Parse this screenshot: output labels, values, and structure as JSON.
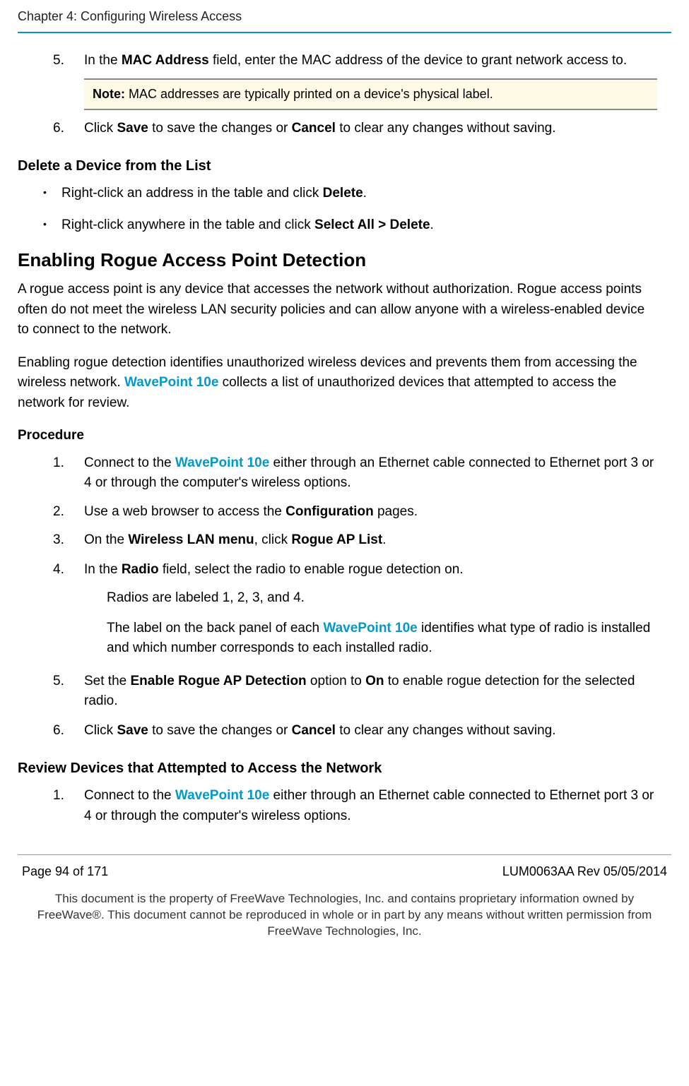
{
  "header": {
    "chapter": "Chapter 4: Configuring Wireless Access"
  },
  "step5": {
    "num": "5.",
    "text_pre": "In the ",
    "bold1": "MAC Address",
    "text_post": " field, enter the MAC address of the device to grant network access to."
  },
  "note": {
    "label": "Note:",
    "text": " MAC addresses are typically printed on a device's physical label."
  },
  "step6": {
    "num": "6.",
    "text_pre": "Click ",
    "bold1": "Save",
    "text_mid": " to save the changes or ",
    "bold2": "Cancel",
    "text_post": " to clear any changes without saving."
  },
  "delete_section": {
    "title": "Delete a Device from the List",
    "bullet1_pre": "Right-click an address in the table and click ",
    "bullet1_bold": "Delete",
    "bullet1_post": ".",
    "bullet2_pre": "Right-click anywhere in the table and click ",
    "bullet2_bold": "Select All > Delete",
    "bullet2_post": "."
  },
  "rogue_section": {
    "title": "Enabling Rogue Access Point Detection",
    "para1": "A rogue access point is any device that accesses the network without authorization. Rogue access points often do not meet the wireless LAN security policies and can allow anyone with a wireless-enabled device to connect to the network.",
    "para2_pre": "Enabling rogue detection identifies unauthorized wireless devices and prevents them from accessing the wireless network. ",
    "para2_link": "WavePoint 10e",
    "para2_post": " collects a list of unauthorized devices that attempted to access the network for review."
  },
  "procedure": {
    "title": "Procedure",
    "s1": {
      "num": "1.",
      "pre": "Connect to the ",
      "link": "WavePoint 10e",
      "post": " either through an Ethernet cable connected to Ethernet port 3 or 4 or through the computer's wireless options."
    },
    "s2": {
      "num": "2.",
      "pre": "Use a web browser to access the ",
      "bold": "Configuration",
      "post": " pages."
    },
    "s3": {
      "num": "3.",
      "pre": "On the ",
      "bold1": "Wireless LAN menu",
      "mid": ", click ",
      "bold2": "Rogue AP List",
      "post": "."
    },
    "s4": {
      "num": "4.",
      "pre": "In the ",
      "bold": "Radio",
      "post": " field, select the radio to enable rogue detection on.",
      "sub1": "Radios are labeled 1, 2, 3, and 4.",
      "sub2_pre": "The label on the back panel of each ",
      "sub2_link": "WavePoint 10e",
      "sub2_post": " identifies what type of radio is installed and which number corresponds to each installed radio."
    },
    "s5": {
      "num": "5.",
      "pre": "Set the ",
      "bold1": "Enable Rogue AP Detection",
      "mid": " option to ",
      "bold2": "On",
      "post": " to enable rogue detection for the selected radio."
    },
    "s6": {
      "num": "6.",
      "pre": "Click ",
      "bold1": "Save",
      "mid": " to save the changes or ",
      "bold2": "Cancel",
      "post": " to clear any changes without saving."
    }
  },
  "review_section": {
    "title": "Review Devices that Attempted to Access the Network",
    "s1": {
      "num": "1.",
      "pre": "Connect to the ",
      "link": "WavePoint 10e",
      "post": " either through an Ethernet cable connected to Ethernet port 3 or 4 or through the computer's wireless options."
    }
  },
  "footer": {
    "page": "Page 94 of 171",
    "rev": "LUM0063AA Rev 05/05/2014",
    "legal": "This document is the property of FreeWave Technologies, Inc. and contains proprietary information owned by FreeWave®. This document cannot be reproduced in whole or in part by any means without written permission from FreeWave Technologies, Inc."
  }
}
